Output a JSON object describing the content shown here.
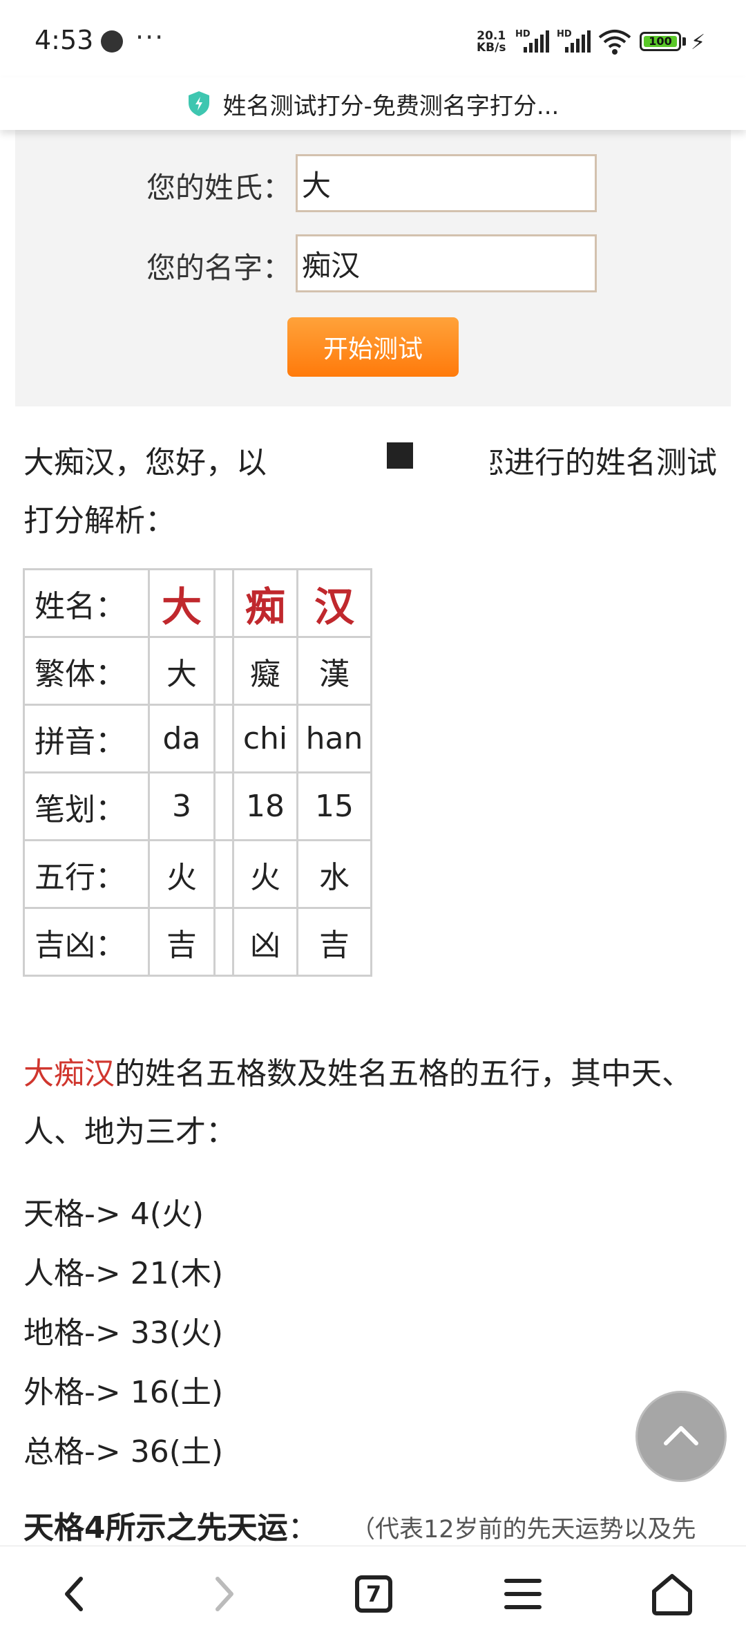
{
  "status_bar": {
    "time": "4:53",
    "overflow": "···",
    "net_speed_value": "20.1",
    "net_speed_unit": "KB/s",
    "sim1_label": "HD",
    "sim2_label": "HD",
    "battery": "100"
  },
  "url_bar": {
    "title": "姓名测试打分-免费测名字打分..."
  },
  "form": {
    "surname_label": "您的姓氏：",
    "surname_value": "大",
    "given_label": "您的名字：",
    "given_value": "痴汉",
    "submit_label": "开始测试"
  },
  "intro": {
    "part1": "大痴汉，您好，以",
    "part2": "您进行的姓名测试打分解析："
  },
  "table": {
    "rows": [
      {
        "label": "姓名：",
        "c1": "大",
        "c2": "痴",
        "c3": "汉"
      },
      {
        "label": "繁体：",
        "c1": "大",
        "c2": "癡",
        "c3": "漢"
      },
      {
        "label": "拼音：",
        "c1": "da",
        "c2": "chi",
        "c3": "han"
      },
      {
        "label": "笔划：",
        "c1": "3",
        "c2": "18",
        "c3": "15"
      },
      {
        "label": "五行：",
        "c1": "火",
        "c2": "火",
        "c3": "水"
      },
      {
        "label": "吉凶：",
        "c1": "吉",
        "c2": "凶",
        "c3": "吉"
      }
    ]
  },
  "grid_intro": {
    "name": "大痴汉",
    "text": "的姓名五格数及姓名五格的五行，其中天、人、地为三才："
  },
  "grids": [
    "天格-> 4(火)",
    "人格-> 21(木)",
    "地格-> 33(火)",
    "外格-> 16(土)",
    "总格-> 36(土)"
  ],
  "tiange": {
    "heading": "天格4所示之先天运",
    "colon": "：",
    "note": "（代表12岁前的先天运势以及先"
  },
  "bottom_nav": {
    "tabs_count": "7"
  },
  "icons": {
    "shield": "shield-icon",
    "scroll_top": "chevron-up-icon",
    "back": "chevron-left-icon",
    "forward": "chevron-right-icon",
    "tabs": "tabs-icon",
    "menu": "menu-icon",
    "home": "home-icon"
  },
  "colors": {
    "accent_orange": "#ff8a1e",
    "name_red": "#c0282d",
    "shield_teal": "#3ec6b0"
  }
}
